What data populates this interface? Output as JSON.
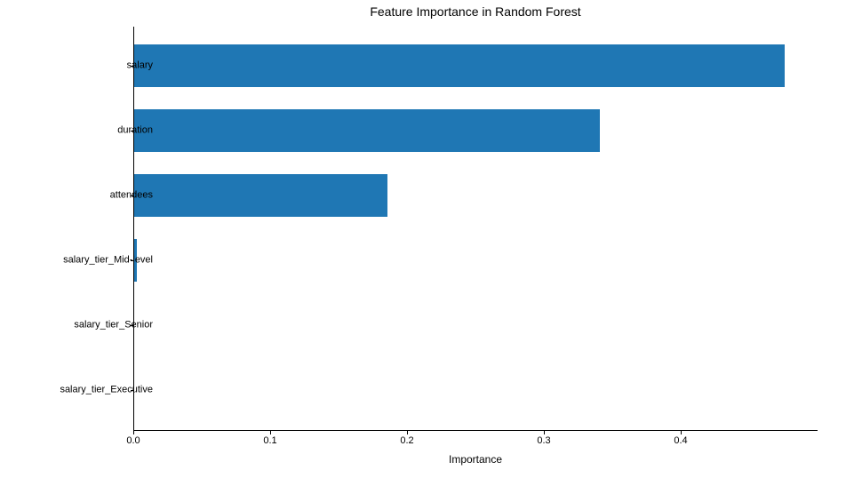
{
  "chart_data": {
    "type": "bar",
    "orientation": "horizontal",
    "title": "Feature Importance in Random Forest",
    "xlabel": "Importance",
    "ylabel": "",
    "xlim": [
      0,
      0.5
    ],
    "categories": [
      "salary",
      "duration",
      "attendees",
      "salary_tier_Mid-level",
      "salary_tier_Senior",
      "salary_tier_Executive"
    ],
    "values": [
      0.475,
      0.34,
      0.185,
      0.002,
      0.0,
      0.0
    ],
    "x_ticks": [
      0.0,
      0.1,
      0.2,
      0.3,
      0.4
    ],
    "x_tick_labels": [
      "0.0",
      "0.1",
      "0.2",
      "0.3",
      "0.4"
    ],
    "bar_color": "#1f77b4"
  }
}
